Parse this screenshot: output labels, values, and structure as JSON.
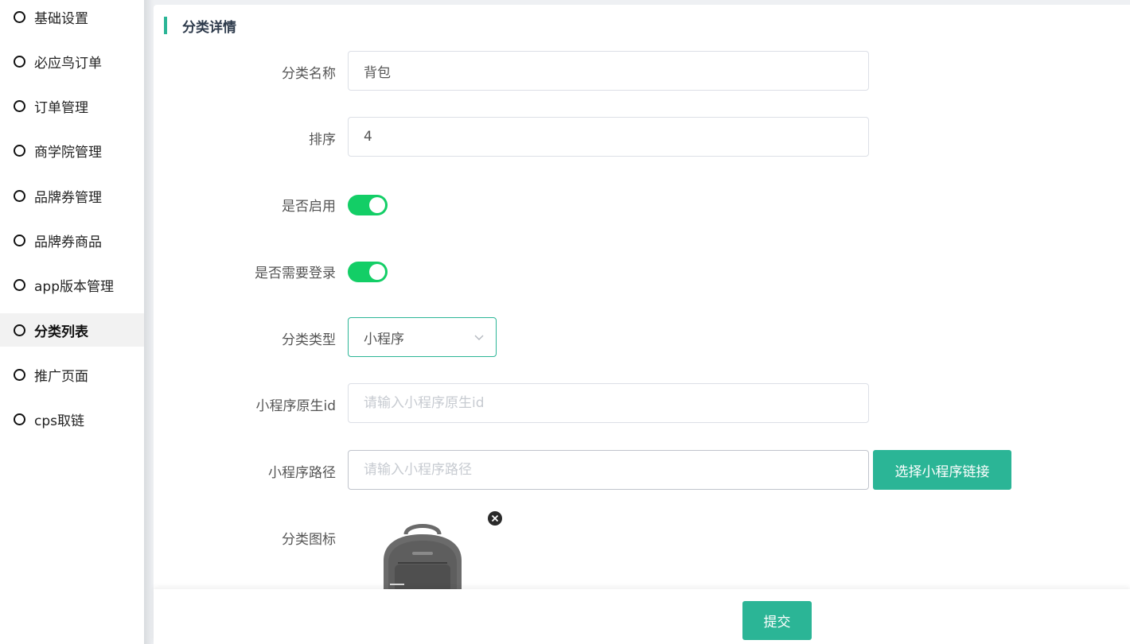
{
  "sidebar": {
    "items": [
      {
        "label": "基础设置",
        "active": false
      },
      {
        "label": "必应鸟订单",
        "active": false
      },
      {
        "label": "订单管理",
        "active": false
      },
      {
        "label": "商学院管理",
        "active": false
      },
      {
        "label": "品牌券管理",
        "active": false
      },
      {
        "label": "品牌券商品",
        "active": false
      },
      {
        "label": "app版本管理",
        "active": false
      },
      {
        "label": "分类列表",
        "active": true
      },
      {
        "label": "推广页面",
        "active": false
      },
      {
        "label": "cps取链",
        "active": false
      }
    ]
  },
  "main": {
    "section_title": "分类详情",
    "form": {
      "name_label": "分类名称",
      "name_value": "背包",
      "sort_label": "排序",
      "sort_value": "4",
      "enabled_label": "是否启用",
      "enabled_value": true,
      "login_label": "是否需要登录",
      "login_value": true,
      "type_label": "分类类型",
      "type_value": "小程序",
      "appid_label": "小程序原生id",
      "appid_placeholder": "请输入小程序原生id",
      "path_label": "小程序路径",
      "path_placeholder": "请输入小程序路径",
      "pick_link_label": "选择小程序链接",
      "icon_label": "分类图标"
    },
    "submit_label": "提交"
  },
  "colors": {
    "accent": "#2bb596",
    "switch_on": "#13ce66"
  }
}
